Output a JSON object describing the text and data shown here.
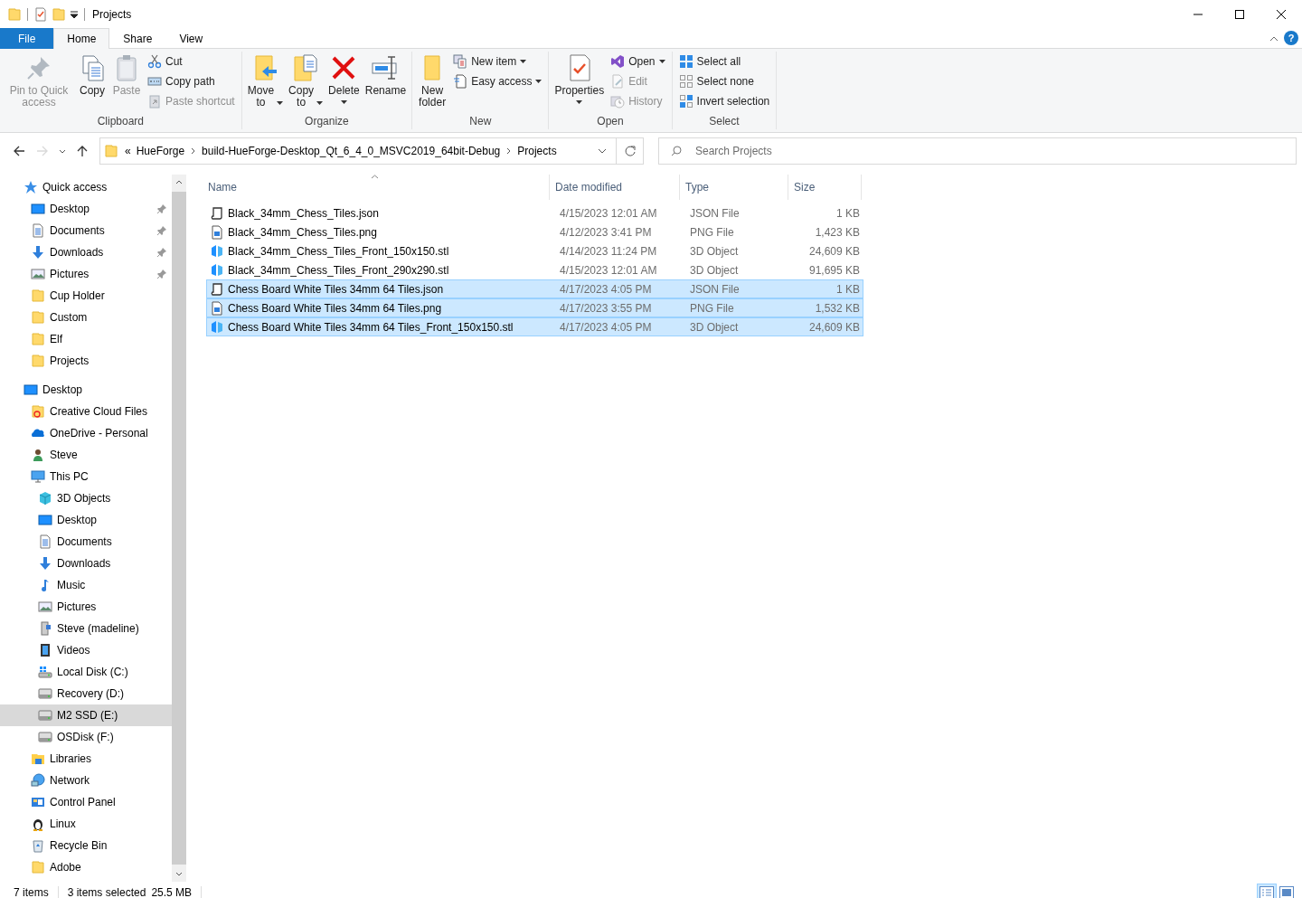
{
  "title_bar": {
    "title": "Projects",
    "quick_tools": [
      {
        "kind": "folder"
      },
      {
        "kind": "properties"
      },
      {
        "kind": "newfolder"
      }
    ]
  },
  "ribbon_tabs": [
    {
      "label": "File",
      "kind": "file",
      "selected": false
    },
    {
      "label": "Home",
      "kind": "tab",
      "selected": true
    },
    {
      "label": "Share",
      "kind": "tab",
      "selected": false
    },
    {
      "label": "View",
      "kind": "tab",
      "selected": false
    }
  ],
  "help": "?",
  "ribbon_groups": [
    {
      "label": "Clipboard",
      "columns": [
        [
          {
            "label": "Pin to Quick access",
            "kind": "large",
            "disabled": true
          }
        ],
        [
          {
            "label": "Copy",
            "kind": "large",
            "disabled": false
          }
        ],
        [
          {
            "label": "Paste",
            "kind": "large",
            "disabled": true
          }
        ],
        [
          {
            "label": "Cut",
            "kind": "small",
            "disabled": false
          },
          {
            "label": "Copy path",
            "kind": "small",
            "disabled": false
          },
          {
            "label": "Paste shortcut",
            "kind": "small",
            "disabled": true
          }
        ]
      ]
    },
    {
      "label": "Organize",
      "columns": [
        [
          {
            "label": "Move to",
            "kind": "large",
            "disabled": false,
            "dropdown": true
          }
        ],
        [
          {
            "label": "Copy to",
            "kind": "large",
            "disabled": false,
            "dropdown": true
          }
        ],
        [
          {
            "label": "Delete",
            "kind": "large",
            "disabled": false,
            "dropdown": true
          }
        ],
        [
          {
            "label": "Rename",
            "kind": "large",
            "disabled": false
          }
        ]
      ]
    },
    {
      "label": "New",
      "columns": [
        [
          {
            "label": "New folder",
            "kind": "large",
            "disabled": false
          }
        ],
        [
          {
            "label": "New item",
            "kind": "small",
            "disabled": false,
            "dropdown": true
          },
          {
            "label": "Easy access",
            "kind": "small",
            "disabled": false,
            "dropdown": true
          }
        ]
      ]
    },
    {
      "label": "Open",
      "columns": [
        [
          {
            "label": "Properties",
            "kind": "large",
            "disabled": false,
            "dropdown": true
          }
        ],
        [
          {
            "label": "Open",
            "kind": "small",
            "disabled": false,
            "dropdown": true
          },
          {
            "label": "Edit",
            "kind": "small",
            "disabled": true
          },
          {
            "label": "History",
            "kind": "small",
            "disabled": true
          }
        ]
      ]
    },
    {
      "label": "Select",
      "columns": [
        [
          {
            "label": "Select all",
            "kind": "small",
            "disabled": false
          },
          {
            "label": "Select none",
            "kind": "small",
            "disabled": false
          },
          {
            "label": "Invert selection",
            "kind": "small",
            "disabled": false
          }
        ]
      ]
    }
  ],
  "navigation": {
    "back_disabled": false,
    "forward_disabled": true
  },
  "address_bar": {
    "overflow": "«",
    "breadcrumbs": [
      "HueForge",
      "build-HueForge-Desktop_Qt_6_4_0_MSVC2019_64bit-Debug",
      "Projects"
    ]
  },
  "search": {
    "placeholder": "Search Projects"
  },
  "nav_pane": [
    {
      "label": "Quick access",
      "kind": "star",
      "selected": false,
      "children": [
        {
          "label": "Desktop",
          "kind": "desktop",
          "selected": false,
          "pinned": true
        },
        {
          "label": "Documents",
          "kind": "documents",
          "selected": false,
          "pinned": true
        },
        {
          "label": "Downloads",
          "kind": "downloads",
          "selected": false,
          "pinned": true
        },
        {
          "label": "Pictures",
          "kind": "pictures",
          "selected": false,
          "pinned": true
        },
        {
          "label": "Cup Holder",
          "kind": "folder",
          "selected": false,
          "pinned": false
        },
        {
          "label": "Custom",
          "kind": "folder",
          "selected": false,
          "pinned": false
        },
        {
          "label": "Elf",
          "kind": "folder",
          "selected": false,
          "pinned": false
        },
        {
          "label": "Projects",
          "kind": "folder",
          "selected": false,
          "pinned": false
        }
      ]
    },
    {
      "label": "Desktop",
      "kind": "desktop",
      "selected": false,
      "children": [
        {
          "label": "Creative Cloud Files",
          "kind": "ccfolder",
          "selected": false
        },
        {
          "label": "OneDrive - Personal",
          "kind": "cloud",
          "selected": false
        },
        {
          "label": "Steve",
          "kind": "user",
          "selected": false
        },
        {
          "label": "This PC",
          "kind": "pc",
          "selected": false,
          "children": [
            {
              "label": "3D Objects",
              "kind": "cube",
              "selected": false
            },
            {
              "label": "Desktop",
              "kind": "desktop",
              "selected": false
            },
            {
              "label": "Documents",
              "kind": "documents",
              "selected": false
            },
            {
              "label": "Downloads",
              "kind": "downloads",
              "selected": false
            },
            {
              "label": "Music",
              "kind": "music",
              "selected": false
            },
            {
              "label": "Pictures",
              "kind": "pictures",
              "selected": false
            },
            {
              "label": "Steve (madeline)",
              "kind": "usb",
              "selected": false
            },
            {
              "label": "Videos",
              "kind": "videos",
              "selected": false
            },
            {
              "label": "Local Disk (C:)",
              "kind": "windisk",
              "selected": false
            },
            {
              "label": "Recovery (D:)",
              "kind": "disk",
              "selected": false
            },
            {
              "label": "M2 SSD (E:)",
              "kind": "disk",
              "selected": true
            },
            {
              "label": "OSDisk (F:)",
              "kind": "disk",
              "selected": false
            }
          ]
        },
        {
          "label": "Libraries",
          "kind": "libraries",
          "selected": false
        },
        {
          "label": "Network",
          "kind": "network",
          "selected": false
        },
        {
          "label": "Control Panel",
          "kind": "control",
          "selected": false
        },
        {
          "label": "Linux",
          "kind": "linux",
          "selected": false
        },
        {
          "label": "Recycle Bin",
          "kind": "recycle",
          "selected": false
        },
        {
          "label": "Adobe",
          "kind": "folder",
          "selected": false
        }
      ]
    }
  ],
  "file_list": {
    "columns": [
      {
        "label": "Name",
        "sorted": true
      },
      {
        "label": "Date modified",
        "sorted": false
      },
      {
        "label": "Type",
        "sorted": false
      },
      {
        "label": "Size",
        "sorted": false
      }
    ],
    "rows": [
      {
        "name": "Black_34mm_Chess_Tiles.json",
        "kind": "json",
        "date": "4/15/2023 12:01 AM",
        "type": "JSON File",
        "size": "1 KB",
        "selected": false
      },
      {
        "name": "Black_34mm_Chess_Tiles.png",
        "kind": "png",
        "date": "4/12/2023 3:41 PM",
        "type": "PNG File",
        "size": "1,423 KB",
        "selected": false
      },
      {
        "name": "Black_34mm_Chess_Tiles_Front_150x150.stl",
        "kind": "stl",
        "date": "4/14/2023 11:24 PM",
        "type": "3D Object",
        "size": "24,609 KB",
        "selected": false
      },
      {
        "name": "Black_34mm_Chess_Tiles_Front_290x290.stl",
        "kind": "stl",
        "date": "4/15/2023 12:01 AM",
        "type": "3D Object",
        "size": "91,695 KB",
        "selected": false
      },
      {
        "name": "Chess Board White Tiles 34mm 64 Tiles.json",
        "kind": "json",
        "date": "4/17/2023 4:05 PM",
        "type": "JSON File",
        "size": "1 KB",
        "selected": true
      },
      {
        "name": "Chess Board White Tiles 34mm 64 Tiles.png",
        "kind": "png",
        "date": "4/17/2023 3:55 PM",
        "type": "PNG File",
        "size": "1,532 KB",
        "selected": true
      },
      {
        "name": "Chess Board White Tiles 34mm 64 Tiles_Front_150x150.stl",
        "kind": "stl",
        "date": "4/17/2023 4:05 PM",
        "type": "3D Object",
        "size": "24,609 KB",
        "selected": true
      }
    ]
  },
  "status_bar": {
    "item_count": "7 items",
    "selection": "3 items selected",
    "selection_size": "25.5 MB",
    "views": [
      {
        "kind": "details",
        "selected": true
      },
      {
        "kind": "large_icons",
        "selected": false
      }
    ]
  }
}
